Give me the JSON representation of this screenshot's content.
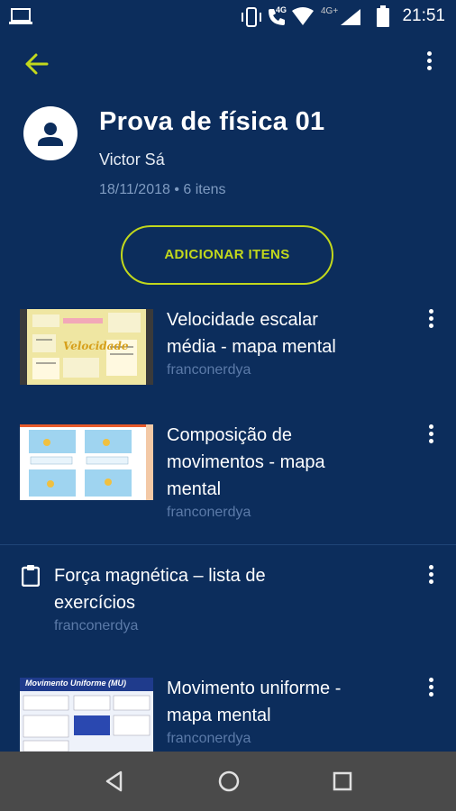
{
  "status_bar": {
    "time": "21:51",
    "network_label": "4G",
    "data_label": "4G+"
  },
  "app_bar": {
    "back_icon": "arrow-left",
    "menu_icon": "more-vert"
  },
  "header": {
    "title": "Prova de física 01",
    "author": "Victor Sá",
    "meta": "18/11/2018 • 6 itens"
  },
  "add_button": {
    "label": "ADICIONAR ITENS"
  },
  "items": [
    {
      "title_line1": "Velocidade escalar",
      "title_line2": "média - mapa mental",
      "author": "franconerdya",
      "thumb_text": "Velocidade"
    },
    {
      "title_line1": "Composição de",
      "title_line2": "movimentos - mapa",
      "title_line3": "mental",
      "author": "franconerdya"
    },
    {
      "title_line1": "Força magnética  – lista de",
      "title_line2": "exercícios",
      "author": "franconerdya"
    },
    {
      "title_line1": "Movimento uniforme -",
      "title_line2": "mapa mental",
      "author": "franconerdya",
      "thumb_text": "Movimento Uniforme (MU)"
    }
  ],
  "colors": {
    "background": "#0c2d5c",
    "accent": "#c2d81c",
    "muted_text": "#5b7aa8",
    "nav_bar": "#4a4a4a"
  }
}
